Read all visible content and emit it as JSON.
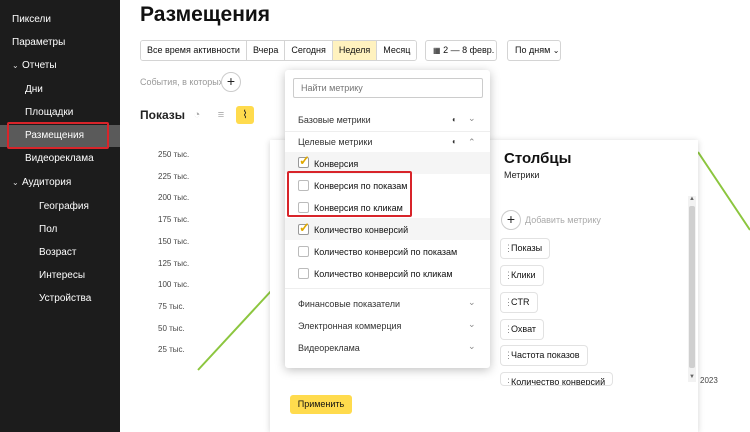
{
  "sidebar": {
    "items": [
      {
        "label": "Пиксели",
        "indent": 0
      },
      {
        "label": "Параметры",
        "indent": 0
      },
      {
        "label": "Отчеты",
        "indent": 0,
        "expanded": true
      },
      {
        "label": "Дни",
        "indent": 1
      },
      {
        "label": "Площадки",
        "indent": 1
      },
      {
        "label": "Размещения",
        "indent": 1,
        "active": true
      },
      {
        "label": "Видеореклама",
        "indent": 1
      },
      {
        "label": "Аудитория",
        "indent": 1,
        "expanded": true
      },
      {
        "label": "География",
        "indent": 2
      },
      {
        "label": "Пол",
        "indent": 2
      },
      {
        "label": "Возраст",
        "indent": 2
      },
      {
        "label": "Интересы",
        "indent": 2
      },
      {
        "label": "Устройства",
        "indent": 2
      }
    ]
  },
  "page": {
    "title": "Размещения"
  },
  "period": {
    "tabs": [
      "Все время активности",
      "Вчера",
      "Сегодня",
      "Неделя",
      "Месяц"
    ],
    "active": "Неделя",
    "date_range": "2 — 8 февр.",
    "grouping": "По дням"
  },
  "events": {
    "label": "События, в которых"
  },
  "chart_section": {
    "label": "Показы"
  },
  "chart_data": {
    "type": "line",
    "y_ticks": [
      "250 тыс.",
      "225 тыс.",
      "200 тыс.",
      "175 тыс.",
      "150 тыс.",
      "125 тыс.",
      "100 тыс.",
      "75 тыс.",
      "50 тыс.",
      "25 тыс."
    ],
    "ylim": [
      0,
      250000
    ],
    "x_suffix_visible": "2023",
    "series": [
      {
        "color": "#8cc63f"
      }
    ]
  },
  "metric_dropdown": {
    "search_placeholder": "Найти метрику",
    "groups": [
      {
        "label": "Базовые метрики",
        "expanded": false
      },
      {
        "label": "Целевые метрики",
        "expanded": true
      }
    ],
    "items": [
      {
        "label": "Конверсия",
        "checked": true
      },
      {
        "label": "Конверсия по показам",
        "checked": false
      },
      {
        "label": "Конверсия по кликам",
        "checked": false
      },
      {
        "label": "Количество конверсий",
        "checked": true
      },
      {
        "label": "Количество конверсий по показам",
        "checked": false
      },
      {
        "label": "Количество конверсий по кликам",
        "checked": false
      }
    ],
    "more_groups": [
      "Финансовые показатели",
      "Электронная коммерция",
      "Видеореклама"
    ]
  },
  "columns_panel": {
    "title": "Столбцы",
    "subtitle": "Метрики",
    "add_metric": "Добавить метрику",
    "metrics": [
      "Показы",
      "Клики",
      "CTR",
      "Охват",
      "Частота показов",
      "Количество конверсий"
    ],
    "apply": "Применить"
  },
  "colors": {
    "accent": "#ffdb4d",
    "highlight": "#d8242a",
    "line": "#8cc63f",
    "sidebar_bg": "#1c1c1c"
  }
}
